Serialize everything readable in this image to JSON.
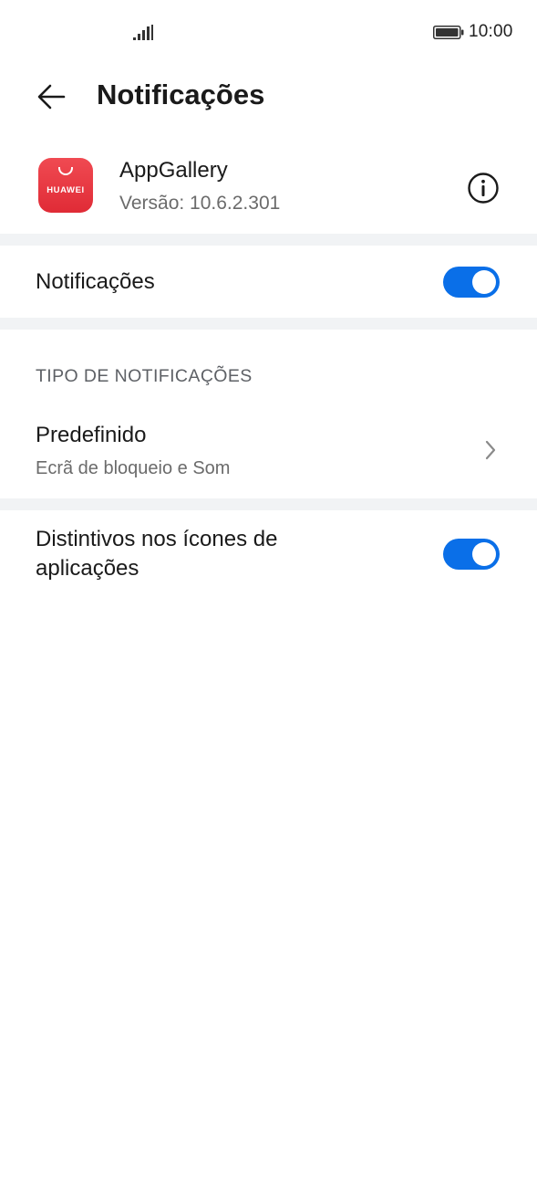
{
  "status_bar": {
    "time": "10:00",
    "signal_icon": "signal-icon",
    "battery_icon": "battery-icon"
  },
  "header": {
    "title": "Notificações",
    "back_icon": "arrow-left-icon"
  },
  "app": {
    "name": "AppGallery",
    "version": "Versão: 10.6.2.301",
    "icon_brand": "HUAWEI",
    "icon_color": "#e8333d",
    "info_icon": "info-icon"
  },
  "notifications_row": {
    "label": "Notificações",
    "enabled": true
  },
  "section": {
    "title": "TIPO DE NOTIFICAÇÕES"
  },
  "predefined_row": {
    "label": "Predefinido",
    "subtitle": "Ecrã de bloqueio e Som",
    "icon": "chevron-right-icon"
  },
  "badges_row": {
    "label_line1": "Distintivos nos ícones de",
    "label_line2": "aplicações",
    "enabled": true
  },
  "colors": {
    "accent": "#0a6fe8",
    "divider": "#f1f3f5",
    "secondary_text": "#6b6b6b"
  }
}
